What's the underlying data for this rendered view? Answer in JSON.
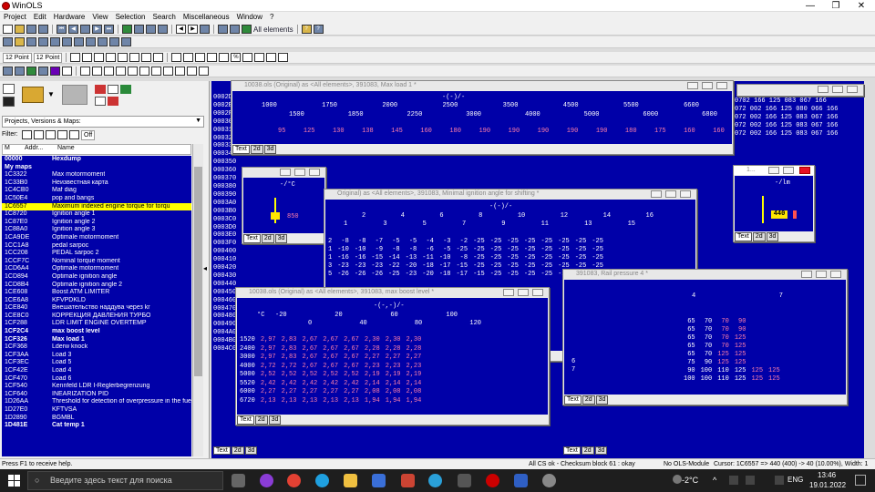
{
  "app": {
    "title": "WinOLS"
  },
  "window_controls": {
    "minimize": "—",
    "maximize": "❐",
    "close": "✕"
  },
  "menu": [
    "Project",
    "Edit",
    "Hardware",
    "View",
    "Selection",
    "Search",
    "Miscellaneous",
    "Window",
    "?"
  ],
  "toolbar": {
    "filter_label": "All elements",
    "font_left": "12 Point",
    "font_right": "12 Point"
  },
  "panel": {
    "dropdown": "Projects, Versions & Maps:",
    "filter_label": "Filter:",
    "off_label": "Off",
    "col_m": "M",
    "col_addr": "Addr...",
    "col_name": "Name"
  },
  "maps": [
    {
      "addr": "00000",
      "name": "Hexdump",
      "bold": true
    },
    {
      "addr": "My maps",
      "name": "",
      "bold": true
    },
    {
      "addr": "1C3322",
      "name": "Max motormoment"
    },
    {
      "addr": "1C33B0",
      "name": "Неизвестная карта"
    },
    {
      "addr": "1C4CB0",
      "name": "Maf diag"
    },
    {
      "addr": "1C50E4",
      "name": "pop and bangs"
    },
    {
      "addr": "1C6557",
      "name": "Maximum indexed engine torque for torqu",
      "hl": true
    },
    {
      "addr": "1C8720",
      "name": "Ignition angle 1"
    },
    {
      "addr": "1C87E0",
      "name": "Ignition angle 2"
    },
    {
      "addr": "1C88A0",
      "name": "Ignition angle 3"
    },
    {
      "addr": "1CA9DE",
      "name": "Optimale motormoment"
    },
    {
      "addr": "1CC1A8",
      "name": "pedal sarpoc"
    },
    {
      "addr": "1CC208",
      "name": "PEDAL sarpoc 2"
    },
    {
      "addr": "1CCF7C",
      "name": "Nominal torque moment"
    },
    {
      "addr": "1CD6A4",
      "name": "Optimale motormoment"
    },
    {
      "addr": "1CD894",
      "name": "Optimale ignition angle"
    },
    {
      "addr": "1CD8B4",
      "name": "Optimale ignition angle 2"
    },
    {
      "addr": "1CE608",
      "name": "Boost ATM LIMITER"
    },
    {
      "addr": "1CE6A8",
      "name": "KFVPDKLD"
    },
    {
      "addr": "1CE840",
      "name": "Внешательство наддува через kr"
    },
    {
      "addr": "1CE8C0",
      "name": "КОРРЕКЦИЯ ДАВЛЕНИЯ ТУРБО"
    },
    {
      "addr": "1CF288",
      "name": "LDR LIMIT  ENGINE OVERTEMP"
    },
    {
      "addr": "1CF2C4",
      "name": "max boost level",
      "bold": true
    },
    {
      "addr": "1CF326",
      "name": "Max load 1",
      "bold": true
    },
    {
      "addr": "1CF368",
      "name": "Lderw knock"
    },
    {
      "addr": "1CF3AA",
      "name": "Load 3"
    },
    {
      "addr": "1CF3EC",
      "name": "Load 5"
    },
    {
      "addr": "1CF42E",
      "name": "Load 4"
    },
    {
      "addr": "1CF470",
      "name": "Load 6"
    },
    {
      "addr": "1CF540",
      "name": "Kennfeld LDR I-Reglerbegrenzung"
    },
    {
      "addr": "1CF640",
      "name": "INEARIZATION PID"
    },
    {
      "addr": "1D26AA",
      "name": "Threshold for detection of overpressure in the fue"
    },
    {
      "addr": "1D27E0",
      "name": "KFTVSA"
    },
    {
      "addr": "1D2890",
      "name": "BGMBL"
    },
    {
      "addr": "1D481E",
      "name": "Cat temp 1",
      "bold": true
    }
  ],
  "hex_rows": [
    "0002D0",
    "0002E0",
    "0002F0",
    "000300",
    "000310",
    "000320",
    "000330",
    "000340",
    "000350",
    "000360",
    "000370",
    "000380",
    "000390",
    "0003A0",
    "0003B0",
    "0003C0",
    "0003D0",
    "0003E0",
    "0003F0",
    "000400",
    "000410",
    "000420",
    "000430",
    "000440",
    "000450",
    "000460",
    "000470",
    "000480",
    "000490",
    "0004A0",
    "0004B0",
    "0004C0"
  ],
  "windows": {
    "maxload": {
      "title": "10038.ols (Original) as <All elements>, 391083, Max load 1 *",
      "axis": "-(-)/-",
      "x1": [
        "1000",
        "1750",
        "2000",
        "2500",
        "3500",
        "4500",
        "5500",
        "6600"
      ],
      "x2": [
        "1500",
        "1850",
        "2250",
        "3000",
        "4000",
        "5000",
        "6000",
        "6800"
      ],
      "vals": [
        "95",
        "125",
        "130",
        "138",
        "145",
        "160",
        "180",
        "190",
        "190",
        "190",
        "190",
        "190",
        "180",
        "175",
        "160",
        "160"
      ]
    },
    "minign": {
      "title": "Original) as <All elements>, 391083, Minimal ignition angle for shifting *",
      "axis": "-(-)/-",
      "hdr": [
        "2",
        "4",
        "6",
        "8",
        "10",
        "12",
        "14",
        "16"
      ],
      "hdr2": [
        "1",
        "3",
        "5",
        "7",
        "9",
        "11",
        "13",
        "15"
      ],
      "rows": [
        [
          "2",
          "-8",
          "-8",
          "-7",
          "-5",
          "-5",
          "-4",
          "-3",
          "-2",
          "-25",
          "-25",
          "-25",
          "-25",
          "-25",
          "-25",
          "-25",
          "-25"
        ],
        [
          "1",
          "-10",
          "-10",
          "-9",
          "-8",
          "-8",
          "-6",
          "-5",
          "-25",
          "-25",
          "-25",
          "-25",
          "-25",
          "-25",
          "-25",
          "-25",
          "-25"
        ],
        [
          "1",
          "-16",
          "-16",
          "-15",
          "-14",
          "-13",
          "-11",
          "-10",
          "-8",
          "-25",
          "-25",
          "-25",
          "-25",
          "-25",
          "-25",
          "-25",
          "-25"
        ],
        [
          "3",
          "-23",
          "-23",
          "-23",
          "-22",
          "-20",
          "-18",
          "-17",
          "-15",
          "-25",
          "-25",
          "-25",
          "-25",
          "-25",
          "-25",
          "-25",
          "-25"
        ],
        [
          "5",
          "-26",
          "-26",
          "-26",
          "-25",
          "-23",
          "-20",
          "-18",
          "-17",
          "-15",
          "-25",
          "-25",
          "-25",
          "-25",
          "-25",
          "-25",
          "-25"
        ]
      ]
    },
    "boost": {
      "title": "10038.ols (Original) as <All elements>, 391083, max boost level *",
      "axis": "-(-,-)/-",
      "unit": "°C",
      "hdr": [
        "-20",
        "20",
        "60",
        "100"
      ],
      "hdr2": [
        "0",
        "40",
        "80",
        "120"
      ],
      "rows": [
        [
          "1520",
          "2,97",
          "2,83",
          "2,67",
          "2,67",
          "2,67",
          "2,30",
          "2,30",
          "2,30"
        ],
        [
          "2400",
          "2,97",
          "2,83",
          "2,67",
          "2,67",
          "2,67",
          "2,28",
          "2,28",
          "2,28"
        ],
        [
          "3000",
          "2,97",
          "2,83",
          "2,67",
          "2,67",
          "2,67",
          "2,27",
          "2,27",
          "2,27"
        ],
        [
          "4000",
          "2,72",
          "2,72",
          "2,67",
          "2,67",
          "2,67",
          "2,23",
          "2,23",
          "2,23"
        ],
        [
          "5000",
          "2,52",
          "2,52",
          "2,52",
          "2,52",
          "2,52",
          "2,19",
          "2,19",
          "2,19"
        ],
        [
          "5520",
          "2,42",
          "2,42",
          "2,42",
          "2,42",
          "2,42",
          "2,14",
          "2,14",
          "2,14"
        ],
        [
          "6000",
          "2,27",
          "2,27",
          "2,27",
          "2,27",
          "2,27",
          "2,08",
          "2,08",
          "2,08"
        ],
        [
          "6720",
          "2,13",
          "2,13",
          "2,13",
          "2,13",
          "2,13",
          "1,94",
          "1,94",
          "1,94"
        ]
      ]
    },
    "small1": {
      "axis": "-/°C",
      "value": "850"
    },
    "small2": {
      "title": "1...",
      "axis": "-/lm",
      "value": "440"
    },
    "rail": {
      "title": "391083, Rail pressure 4 *",
      "hdr": [
        "4",
        "7"
      ],
      "rows": [
        [
          "65",
          "70",
          "70",
          "90"
        ],
        [
          "65",
          "70",
          "70",
          "90"
        ],
        [
          "65",
          "70",
          "70",
          "125"
        ],
        [
          "65",
          "70",
          "70",
          "125"
        ],
        [
          "65",
          "70",
          "125",
          "125"
        ],
        [
          "75",
          "90",
          "125",
          "125"
        ],
        [
          "90",
          "100",
          "110",
          "125",
          "125",
          "125"
        ],
        [
          "100",
          "100",
          "110",
          "125",
          "125",
          "125"
        ]
      ],
      "left": [
        "6",
        "7"
      ]
    },
    "hexright": {
      "rows": [
        "0702 166 125 083 067 166",
        "072 002 166 125 080 066 166",
        "072 002 166 125 083 067 166",
        "072 002 166 125 083 067 166",
        "072 002 166 125 083 067 166"
      ]
    }
  },
  "tab_labels": {
    "text": "Text",
    "d2": "2d",
    "d3": "3d"
  },
  "status": {
    "left": "Press F1 to receive help.",
    "cs": "All CS ok - Checksum block 61 : okay",
    "module": "No OLS-Module",
    "cursor": "Cursor: 1C6557 => 440 (400) -> 40 (10.00%), Width: 1"
  },
  "taskbar": {
    "search_placeholder": "Введите здесь текст для поиска",
    "temp": "-2°C",
    "lang": "ENG",
    "time": "13:46",
    "date": "19.01.2022"
  }
}
